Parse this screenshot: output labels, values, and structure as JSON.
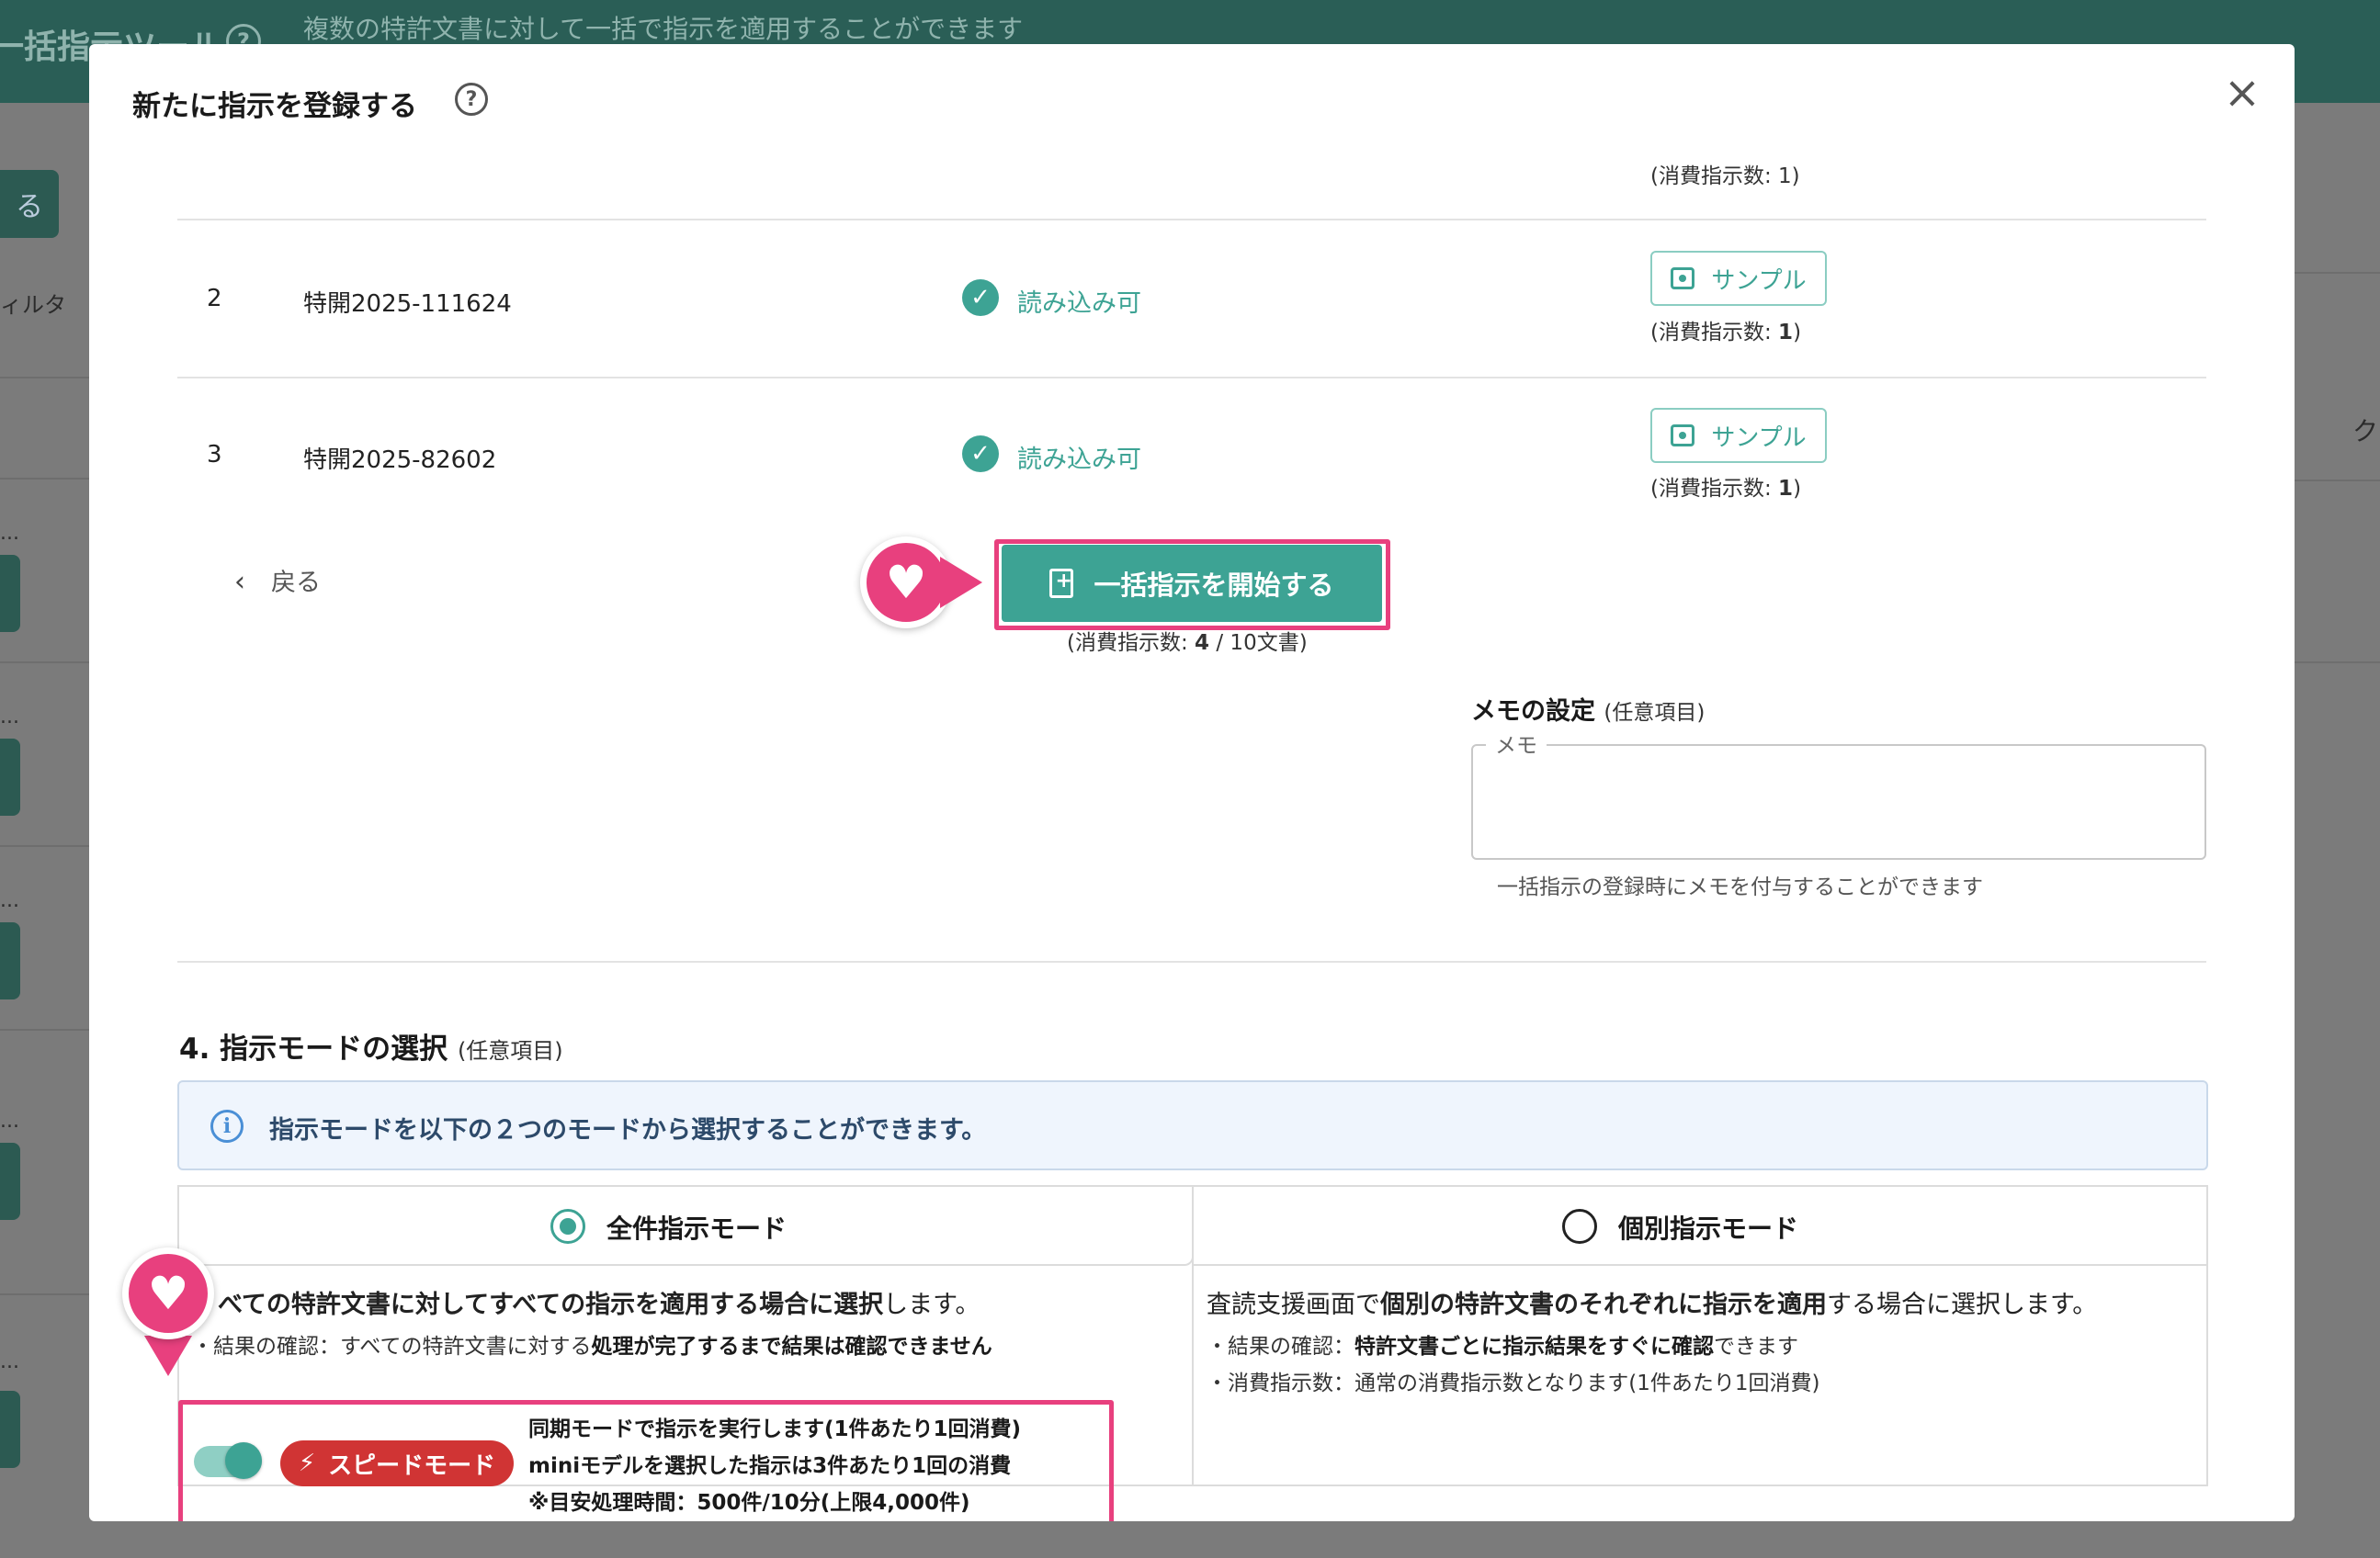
{
  "background": {
    "app_title": "一括指示ツール",
    "app_subtitle": "複数の特許文書に対して一括で指示を適用することができます",
    "left_button": "る",
    "filter_label": "ィルタ",
    "right_text": "ク",
    "row_dots": "..."
  },
  "modal": {
    "title": "新たに指示を登録する",
    "help_icon": "question-circle-icon",
    "close_icon": "close-icon"
  },
  "document_rows": {
    "top_consumed": "(消費指示数: 1)",
    "rows": [
      {
        "num": "2",
        "id": "特開2025-111624",
        "status": "読み込み可",
        "sample_label": "サンプル",
        "consumed_prefix": "(消費指示数: ",
        "consumed_value": "1",
        "consumed_suffix": ")"
      },
      {
        "num": "3",
        "id": "特開2025-82602",
        "status": "読み込み可",
        "sample_label": "サンプル",
        "consumed_prefix": "(消費指示数: ",
        "consumed_value": "1",
        "consumed_suffix": ")"
      }
    ]
  },
  "actions": {
    "back_label": "戻る",
    "start_label": "一括指示を開始する",
    "start_consumed_prefix": "(消費指示数: ",
    "start_consumed_value": "4",
    "start_consumed_suffix": " / 10文書)"
  },
  "memo": {
    "title": "メモの設定",
    "optional": "(任意項目)",
    "field_label": "メモ",
    "value": "",
    "help": "一括指示の登録時にメモを付与することができます"
  },
  "mode_section": {
    "title": "4. 指示モードの選択",
    "optional": "(任意項目)",
    "info": "指示モードを以下の２つのモードから選択することができます。",
    "all_mode": {
      "label": "全件指示モード",
      "selected": true,
      "desc_bold": "べての特許文書に対してすべての指示を適用する場合に選択",
      "desc_tail": "します。",
      "result_prefix": "・結果の確認：すべての特許文書に対する",
      "result_bold": "処理が完了するまで結果は確認できません",
      "speed_mode": {
        "toggle_on": true,
        "badge": "スピードモード",
        "line1": "同期モードで指示を実行します(1件あたり1回消費)",
        "line2": "miniモデルを選択した指示は3件あたり1回の消費",
        "line3": "※目安処理時間：500件/10分(上限4,000件)"
      }
    },
    "individual_mode": {
      "label": "個別指示モード",
      "selected": false,
      "desc_prefix": "査読支援画面で",
      "desc_bold": "個別の特許文書のそれぞれに指示を適用",
      "desc_tail": "する場合に選択します。",
      "result_prefix": "・結果の確認：",
      "result_bold": "特許文書ごとに指示結果をすぐに確認",
      "result_tail": "できます",
      "consume": "・消費指示数：通常の消費指示数となります(1件あたり1回消費)"
    }
  },
  "colors": {
    "accent": "#3da394",
    "highlight": "#e8407e",
    "speed_badge": "#d03434",
    "info_bg": "#eff5fd"
  }
}
